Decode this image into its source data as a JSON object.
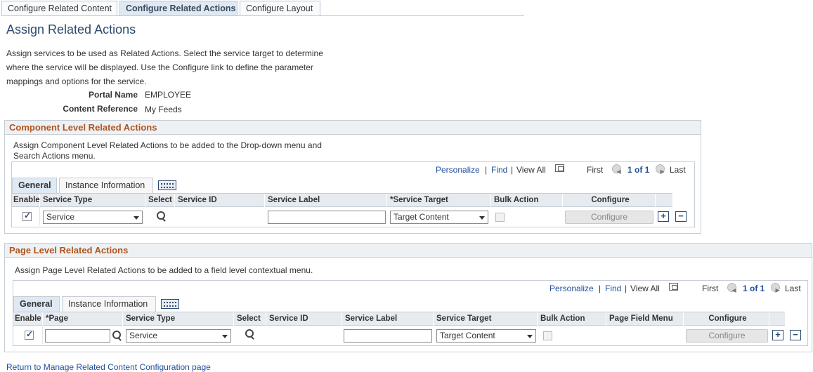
{
  "tabs": [
    {
      "label": "Configure Related Content"
    },
    {
      "label": "Configure Related Actions"
    },
    {
      "label": "Configure Layout"
    }
  ],
  "page": {
    "title": "Assign Related Actions",
    "description": "Assign services to be used as Related Actions. Select the service target to determine where the service will be displayed. Use the Configure link to define the parameter mappings and options for the service.",
    "portal_name_label": "Portal Name",
    "portal_name_value": "EMPLOYEE",
    "content_ref_label": "Content Reference",
    "content_ref_value": "My Feeds",
    "return_link": "Return to Manage Related Content Configuration page"
  },
  "component": {
    "title": "Component Level Related Actions",
    "instructions": "Assign Component Level Related Actions to be added to the Drop-down menu and Search Actions menu.",
    "nav": {
      "personalize": "Personalize",
      "sep1": "|",
      "find": "Find",
      "sep2": "|",
      "view_all": "View All",
      "first": "First",
      "range": "1 of 1",
      "last": "Last"
    },
    "tabs": [
      "General",
      "Instance Information"
    ],
    "headers": {
      "enable": "Enable",
      "service_type": "Service Type",
      "select": "Select",
      "service_id": "Service ID",
      "service_label": "Service Label",
      "service_target": "*Service Target",
      "bulk_action": "Bulk Action",
      "configure": "Configure"
    },
    "row": {
      "enabled": true,
      "service_type": "Service",
      "service_id": "",
      "service_label": "",
      "service_target": "Target Content",
      "bulk_action": false,
      "configure_label": "Configure"
    }
  },
  "pagelevel": {
    "title": "Page Level Related Actions",
    "instructions": "Assign Page Level Related Actions to be added to a field level contextual menu.",
    "nav": {
      "personalize": "Personalize",
      "sep1": "|",
      "find": "Find",
      "sep2": "|",
      "view_all": "View All",
      "first": "First",
      "range": "1 of 1",
      "last": "Last"
    },
    "tabs": [
      "General",
      "Instance Information"
    ],
    "headers": {
      "enable": "Enable",
      "page": "*Page",
      "service_type": "Service Type",
      "select": "Select",
      "service_id": "Service ID",
      "service_label": "Service Label",
      "service_target": "Service Target",
      "bulk_action": "Bulk Action",
      "page_field_menu": "Page Field Menu",
      "configure": "Configure"
    },
    "row": {
      "enabled": true,
      "page": "",
      "service_type": "Service",
      "service_id": "",
      "service_label": "",
      "service_target": "Target Content",
      "bulk_action": false,
      "page_field_menu": "",
      "configure_label": "Configure"
    }
  },
  "icons": {
    "add": "+",
    "remove": "−",
    "first": "◀",
    "last": "▶"
  }
}
